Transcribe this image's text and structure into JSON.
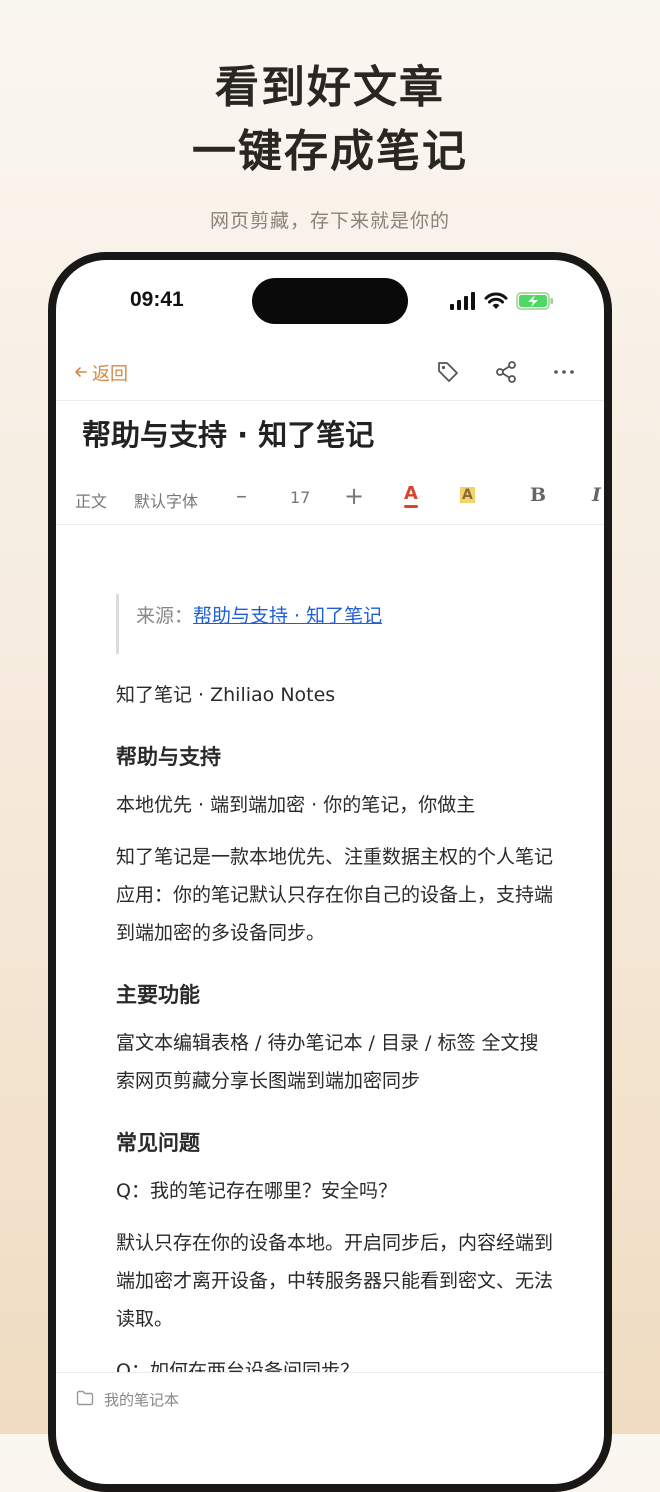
{
  "hero": {
    "title_line1": "看到好文章",
    "title_line2": "一键存成笔记",
    "subtitle": "网页剪藏，存下来就是你的"
  },
  "status_bar": {
    "time": "09:41"
  },
  "nav": {
    "back_label": "返回",
    "icons": [
      "tag-icon",
      "share-icon",
      "more-icon"
    ]
  },
  "doc": {
    "title": "帮助与支持 · 知了笔记"
  },
  "toolbar": {
    "style": "正文",
    "font": "默认字体",
    "minus": "–",
    "size": "17",
    "plus": "+",
    "color_letter": "A",
    "highlight_letter": "A",
    "bold": "B",
    "italic": "I"
  },
  "content": {
    "source_label": "来源：",
    "source_link": "帮助与支持 · 知了笔记",
    "p1": "知了笔记 · Zhiliao Notes",
    "h1": "帮助与支持",
    "p2": "本地优先 · 端到端加密 · 你的笔记，你做主",
    "p3": "知了笔记是一款本地优先、注重数据主权的个人笔记应用：你的笔记默认只存在你自己的设备上，支持端到端加密的多设备同步。",
    "h2": "主要功能",
    "p4": "富文本编辑表格 / 待办笔记本 / 目录 / 标签 全文搜索网页剪藏分享长图端到端加密同步",
    "h3": "常见问题",
    "p5": "Q：我的笔记存在哪里？安全吗？",
    "p6": "默认只存在你的设备本地。开启同步后，内容经端到端加密才离开设备，中转服务器只能看到密文、无法读取。",
    "p7": "Q：如何在两台设备间同步？"
  },
  "bottom": {
    "notebook": "我的笔记本"
  },
  "colors": {
    "accent": "#d08a45",
    "link": "#1f5fd6",
    "text_color_red": "#d9442f",
    "highlight_yellow": "#f2d46b"
  }
}
